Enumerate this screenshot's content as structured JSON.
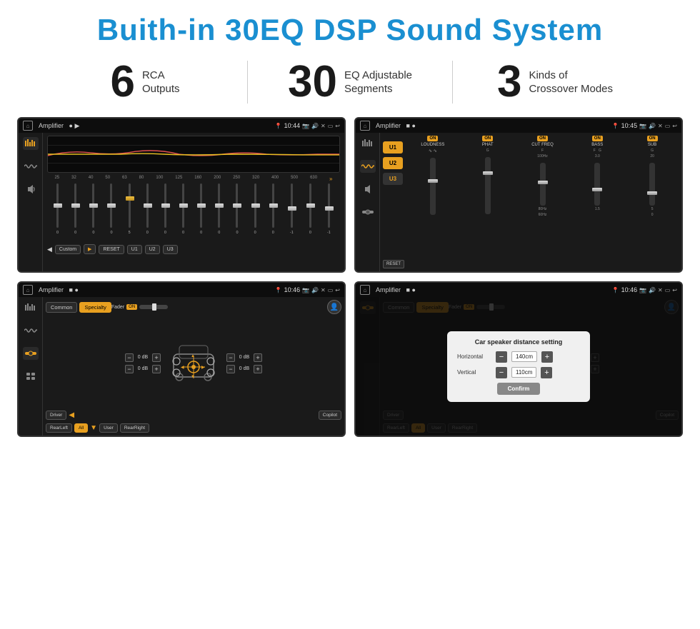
{
  "header": {
    "title": "Buith-in 30EQ DSP Sound System"
  },
  "stats": [
    {
      "number": "6",
      "label": "RCA\nOutputs"
    },
    {
      "number": "30",
      "label": "EQ Adjustable\nSegments"
    },
    {
      "number": "3",
      "label": "Kinds of\nCrossover Modes"
    }
  ],
  "screens": [
    {
      "id": "eq-screen",
      "title": "Amplifier",
      "time": "10:44",
      "type": "eq"
    },
    {
      "id": "crossover-screen",
      "title": "Amplifier",
      "time": "10:45",
      "type": "crossover"
    },
    {
      "id": "speaker-screen",
      "title": "Amplifier",
      "time": "10:46",
      "type": "speaker"
    },
    {
      "id": "distance-screen",
      "title": "Amplifier",
      "time": "10:46",
      "type": "distance",
      "dialog": {
        "title": "Car speaker distance setting",
        "horizontal_label": "Horizontal",
        "horizontal_value": "140cm",
        "vertical_label": "Vertical",
        "vertical_value": "110cm",
        "confirm_label": "Confirm"
      }
    }
  ],
  "eq_freqs": [
    "25",
    "32",
    "40",
    "50",
    "63",
    "80",
    "100",
    "125",
    "160",
    "200",
    "250",
    "320",
    "400",
    "500",
    "630"
  ],
  "eq_vals": [
    "0",
    "0",
    "0",
    "0",
    "5",
    "0",
    "0",
    "0",
    "0",
    "0",
    "0",
    "0",
    "0",
    "-1",
    "0",
    "-1"
  ],
  "eq_buttons": [
    "Custom",
    "RESET",
    "U1",
    "U2",
    "U3"
  ],
  "crossover_presets": [
    "U1",
    "U2",
    "U3"
  ],
  "crossover_channels": [
    {
      "label": "LOUDNESS",
      "on": true
    },
    {
      "label": "PHAT",
      "on": true
    },
    {
      "label": "CUT FREQ",
      "on": true
    },
    {
      "label": "BASS",
      "on": true
    },
    {
      "label": "SUB",
      "on": true
    }
  ],
  "speaker_tabs": [
    "Common",
    "Specialty"
  ],
  "speaker_buttons": [
    "Driver",
    "Copilot",
    "RearLeft",
    "All",
    "User",
    "RearRight"
  ],
  "dialog": {
    "title": "Car speaker distance setting",
    "horizontal": "140cm",
    "vertical": "110cm",
    "confirm": "Confirm"
  }
}
